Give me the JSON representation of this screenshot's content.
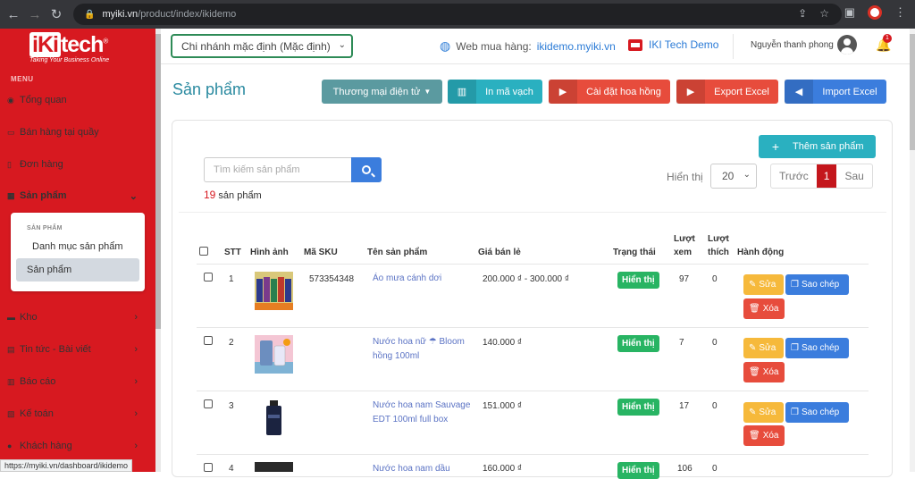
{
  "browser": {
    "url_host": "myiki.vn",
    "url_path": "/product/index/ikidemo"
  },
  "logo": {
    "brand_a": "iKi",
    "brand_b": "tech",
    "reg": "®",
    "tagline": "Taking Your Business Online"
  },
  "sidebar": {
    "menu_label": "MENU",
    "items": [
      {
        "label": "Tổng quan"
      },
      {
        "label": "Bán hàng tại quầy"
      },
      {
        "label": "Đơn hàng"
      },
      {
        "label": "Sản phẩm"
      },
      {
        "label": "Kho"
      },
      {
        "label": "Tin tức - Bài viết"
      },
      {
        "label": "Báo cáo"
      },
      {
        "label": "Kế toán"
      },
      {
        "label": "Khách hàng"
      }
    ],
    "submenu": {
      "header": "SẢN PHẨM",
      "items": [
        {
          "label": "Danh mục sản phẩm"
        },
        {
          "label": "Sản phẩm"
        }
      ]
    }
  },
  "topbar": {
    "branch": "Chi nhánh mặc định (Mặc định)",
    "web_label": "Web mua hàng:",
    "web_link": "ikidemo.myiki.vn",
    "store": "IKI Tech Demo",
    "user": "Nguyễn thanh phong",
    "notif_count": "1"
  },
  "page": {
    "title": "Sản phẩm"
  },
  "toolbar": {
    "ecommerce": "Thương mại điện tử",
    "barcode": "In mã vạch",
    "commission": "Cài đặt hoa hồng",
    "export": "Export Excel",
    "import": "Import Excel"
  },
  "card": {
    "add": "Thêm sản phẩm",
    "search_placeholder": "Tìm kiếm sản phẩm",
    "count_n": "19",
    "count_label": " sản phẩm",
    "show_label": "Hiển thị",
    "page_size": "20",
    "prev": "Trước",
    "page": "1",
    "next": "Sau"
  },
  "table": {
    "headers": {
      "stt": "STT",
      "image": "Hình ảnh",
      "sku": "Mã SKU",
      "name": "Tên sản phẩm",
      "price": "Giá bán lẻ",
      "status": "Trạng thái",
      "views_a": "Lượt",
      "views_b": "xem",
      "likes_a": "Lượt",
      "likes_b": "thích",
      "actions": "Hành động"
    },
    "rows": [
      {
        "stt": "1",
        "sku": "573354348",
        "name": "Áo mưa cánh dơi",
        "price": "200.000 ₫ - 300.000 ₫",
        "status": "Hiển thị",
        "views": "97",
        "likes": "0"
      },
      {
        "stt": "2",
        "sku": "",
        "name": "Nước hoa nữ ☂ Bloom hồng 100ml",
        "price": "140.000 ₫",
        "status": "Hiển thị",
        "views": "7",
        "likes": "0"
      },
      {
        "stt": "3",
        "sku": "",
        "name": "Nước hoa nam Sauvage EDT 100ml full box",
        "price": "151.000 ₫",
        "status": "Hiển thị",
        "views": "17",
        "likes": "0"
      },
      {
        "stt": "4",
        "sku": "",
        "name": "Nước hoa nam dầu",
        "price": "160.000 ₫",
        "status": "Hiển thị",
        "views": "106",
        "likes": "0"
      }
    ],
    "actions": {
      "edit": "Sửa",
      "copy": "Sao chép",
      "delete": "Xóa"
    }
  },
  "status_bar": "https://myiki.vn/dashboard/ikidemo",
  "colors": {
    "brand_red": "#d71920",
    "link_blue": "#2b7bd6",
    "title_teal": "#2a8aa0",
    "badge_green": "#28b463"
  }
}
